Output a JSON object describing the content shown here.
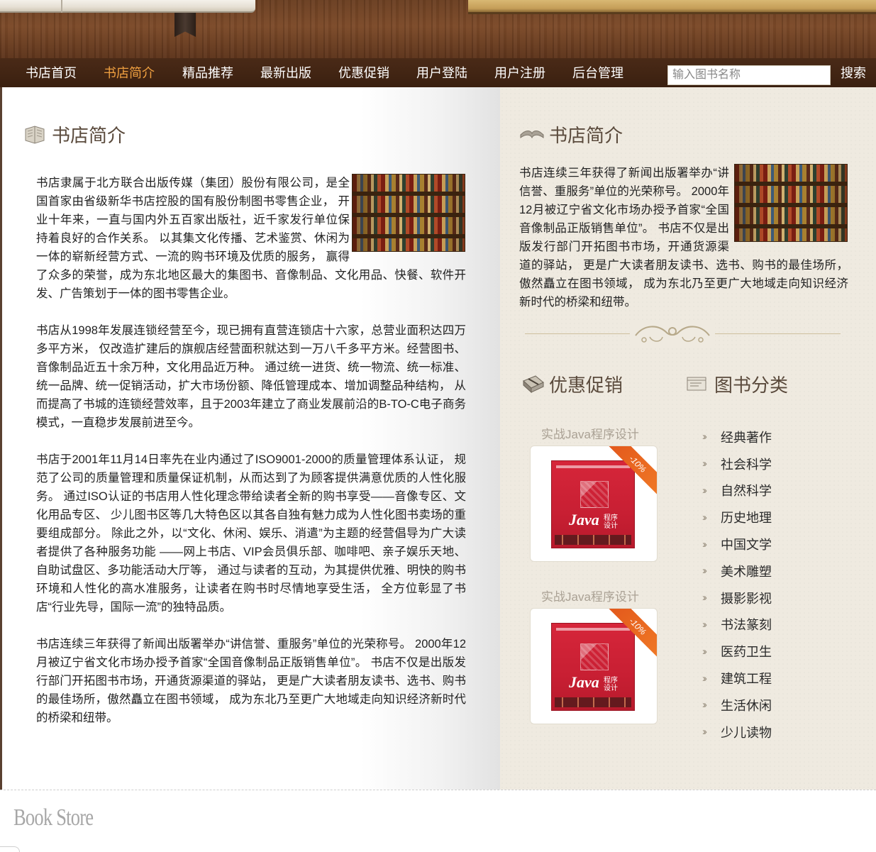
{
  "nav": {
    "items": [
      {
        "label": "书店首页",
        "active": false
      },
      {
        "label": "书店简介",
        "active": true
      },
      {
        "label": "精品推荐",
        "active": false
      },
      {
        "label": "最新出版",
        "active": false
      },
      {
        "label": "优惠促销",
        "active": false
      },
      {
        "label": "用户登陆",
        "active": false
      },
      {
        "label": "用户注册",
        "active": false
      },
      {
        "label": "后台管理",
        "active": false
      }
    ],
    "search_placeholder": "输入图书名称",
    "search_button": "搜索",
    "active_color": "#f0a040"
  },
  "main": {
    "title": "书店简介",
    "paragraphs": [
      "书店隶属于北方联合出版传媒（集团）股份有限公司，是全国首家由省级新华书店控股的国有股份制图书零售企业， 开业十年来，一直与国内外五百家出版社，近千家发行单位保持着良好的合作关系。 以其集文化传播、艺术鉴赏、休闲为一体的崭新经营方式、一流的购书环境及优质的服务， 赢得了众多的荣誉，成为东北地区最大的集图书、音像制品、文化用品、快餐、软件开发、广告策划于一体的图书零售企业。",
      "书店从1998年发展连锁经营至今，现已拥有直营连锁店十六家，总营业面积达四万多平方米， 仅改造扩建后的旗舰店经营面积就达到一万八千多平方米。经营图书、音像制品近五十余万种，文化用品近万种。 通过统一进货、统一物流、统一标准、统一品牌、统一促销活动，扩大市场份额、降低管理成本、增加调整品种结构， 从而提高了书城的连锁经营效率，且于2003年建立了商业发展前沿的B-TO-C电子商务模式，一直稳步发展前进至今。",
      "书店于2001年11月14日率先在业内通过了ISO9001-2000的质量管理体系认证， 规范了公司的质量管理和质量保证机制，从而达到了为顾客提供满意优质的人性化服务。 通过ISO认证的书店用人性化理念带给读者全新的购书享受——音像专区、文化用品专区、 少儿图书区等几大特色区以其各自独有魅力成为人性化图书卖场的重要组成部分。 除此之外，以“文化、休闲、娱乐、消遣”为主题的经营倡导为广大读者提供了各种服务功能 ——网上书店、VIP会员俱乐部、咖啡吧、亲子娱乐天地、自助试盘区、多功能活动大厅等， 通过与读者的互动，为其提供优雅、明快的购书环境和人性化的高水准服务，让读者在购书时尽情地享受生活， 全方位彰显了书店“行业先导，国际一流”的独特品质。",
      "书店连续三年获得了新闻出版署举办“讲信誉、重服务”单位的光荣称号。 2000年12月被辽宁省文化市场办授予首家“全国音像制品正版销售单位”。 书店不仅是出版发行部门开拓图书市场，开通货源渠道的驿站， 更是广大读者朋友读书、选书、购书的最佳场所，傲然矗立在图书领域， 成为东北乃至更广大地域走向知识经济新时代的桥梁和纽带。"
    ]
  },
  "sidebar": {
    "about": {
      "title": "书店简介",
      "text": "书店连续三年获得了新闻出版署举办“讲信誉、重服务”单位的光荣称号。 2000年12月被辽宁省文化市场办授予首家“全国音像制品正版销售单位”。 书店不仅是出版发行部门开拓图书市场，开通货源渠道的驿站， 更是广大读者朋友读书、选书、购书的最佳场所，傲然矗立在图书领域， 成为东北乃至更广大地域走向知识经济新时代的桥梁和纽带。"
    },
    "promo": {
      "title": "优惠促销",
      "items": [
        {
          "name": "实战Java程序设计",
          "discount": "-10%",
          "cover_title": "Java",
          "cover_subtitle": "程序设计"
        },
        {
          "name": "实战Java程序设计",
          "discount": "-10%",
          "cover_title": "Java",
          "cover_subtitle": "程序设计"
        }
      ]
    },
    "categories": {
      "title": "图书分类",
      "items": [
        "经典著作",
        "社会科学",
        "自然科学",
        "历史地理",
        "中国文学",
        "美术雕塑",
        "摄影影视",
        "书法篆刻",
        "医药卫生",
        "建筑工程",
        "生活休闲",
        "少儿读物"
      ]
    }
  },
  "footer": {
    "logo": "Book Store"
  }
}
